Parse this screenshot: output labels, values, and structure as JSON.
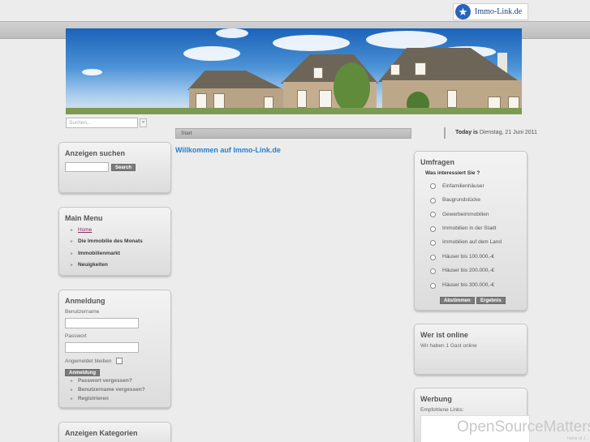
{
  "brand": {
    "logo_text": "Immo-Link.de",
    "logo_icon": "star-badge-icon"
  },
  "search": {
    "placeholder": "Suchen...",
    "go_label": "»"
  },
  "breadcrumb": "Start",
  "main": {
    "heading": "Willkommen auf Immo-Link.de"
  },
  "today": {
    "label": "Today is",
    "date": "Dienstag, 21 Juni 2011"
  },
  "modules": {
    "ads_search": {
      "title": "Anzeigen suchen",
      "button": "Search"
    },
    "main_menu": {
      "title": "Main Menu",
      "items": [
        {
          "label": "Home",
          "active": true
        },
        {
          "label": "Die Immobilie des Monats"
        },
        {
          "label": "Immobilienmarkt"
        },
        {
          "label": "Neuigkeiten"
        }
      ]
    },
    "login": {
      "title": "Anmeldung",
      "username_label": "Benutzername",
      "password_label": "Passwort",
      "remember_label": "Angemeldet bleiben",
      "submit": "Anmeldung",
      "links": [
        "Passwort vergessen?",
        "Benutzername vergessen?",
        "Registrieren"
      ]
    },
    "categories": {
      "title": "Anzeigen Kategorien"
    },
    "poll": {
      "title": "Umfragen",
      "question": "Was interessiert Sie ?",
      "options": [
        "Einfamilienhäuser",
        "Baugrundstücke",
        "Gewerbeimmobilien",
        "Immobilien in der Stadt",
        "Immobilien auf dem Land",
        "Häuser bis 100.000,-€",
        "Häuser bis 200.000,-€",
        "Häuser bis 300.000,-€"
      ],
      "vote_button": "Abstimmen",
      "results_button": "Ergebnis"
    },
    "who_online": {
      "title": "Wer ist online",
      "text": "Wir haben 1 Gast online"
    },
    "ads": {
      "title": "Werbung",
      "label": "Empfohlene Links:",
      "banner_text": "OpenSourceMatters",
      "banner_sub": "home of J..."
    }
  },
  "colors": {
    "accent_link": "#2a7fc9",
    "active_menu": "#8a2a5f",
    "button": "#7b7b7b"
  }
}
